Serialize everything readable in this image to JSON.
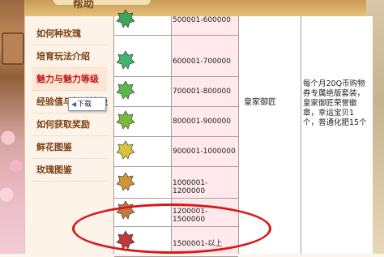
{
  "header": {
    "title": "帮助"
  },
  "sidebar": {
    "items": [
      {
        "label": "如何种玫瑰"
      },
      {
        "label": "培育玩法介绍"
      },
      {
        "label": "魅力与魅力等级"
      },
      {
        "label": "经验值与经验等级"
      },
      {
        "label": "如何获取奖励"
      },
      {
        "label": "鲜花图鉴"
      },
      {
        "label": "玫瑰图鉴"
      }
    ],
    "active_index": 2
  },
  "tooltip": {
    "label": "下载",
    "icon": "download-arrow-icon"
  },
  "table": {
    "rows": [
      {
        "range": "500001-600000",
        "badge_color": "#3fa55a"
      },
      {
        "range": "600001-700000",
        "badge_color": "#46b36a"
      },
      {
        "range": "700001-800000",
        "badge_color": "#5ab84d"
      },
      {
        "range": "800001-900000",
        "badge_color": "#7bb93a"
      },
      {
        "range": "900001-1000000",
        "badge_color": "#d8c43a"
      },
      {
        "range": "1000001-1200000",
        "badge_color": "#d0953a"
      },
      {
        "range": "1200001-1500000",
        "badge_color": "#c47a3d"
      },
      {
        "range": "1500001-以上",
        "badge_color": "#c0393a"
      }
    ],
    "title": "皇家御匠",
    "reward": "每个月20Q币购物券专属绝版套装，皇家御匠荣誉徽章，幸运宝贝1个，普通化肥15个"
  },
  "highlight": {
    "color": "#d81818"
  }
}
